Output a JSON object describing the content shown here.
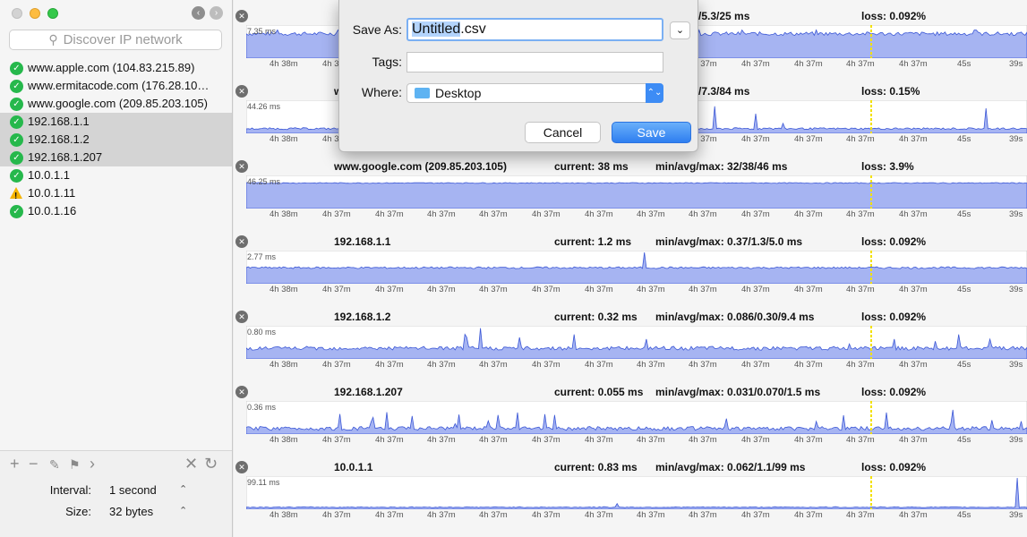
{
  "search": {
    "placeholder": "Discover IP network"
  },
  "hosts": [
    {
      "label": "www.apple.com (104.83.215.89)",
      "status": "ok",
      "selected": false
    },
    {
      "label": "www.ermitacode.com (176.28.10…",
      "status": "ok",
      "selected": false
    },
    {
      "label": "www.google.com (209.85.203.105)",
      "status": "ok",
      "selected": false
    },
    {
      "label": "192.168.1.1",
      "status": "ok",
      "selected": true
    },
    {
      "label": "192.168.1.2",
      "status": "ok",
      "selected": true
    },
    {
      "label": "192.168.1.207",
      "status": "ok",
      "selected": true
    },
    {
      "label": "10.0.1.1",
      "status": "ok",
      "selected": false
    },
    {
      "label": "10.0.1.11",
      "status": "warn",
      "selected": false
    },
    {
      "label": "10.0.1.16",
      "status": "ok",
      "selected": false
    }
  ],
  "settings": {
    "interval_label": "Interval:",
    "interval_value": "1 second",
    "size_label": "Size:",
    "size_value": "32 bytes"
  },
  "time_ticks": [
    "4h 38m",
    "4h 37m",
    "4h 37m",
    "4h 37m",
    "4h 37m",
    "4h 37m",
    "4h 37m",
    "4h 37m",
    "4h 37m",
    "4h 37m",
    "4h 37m",
    "4h 37m",
    "4h 37m",
    "45s",
    "39s"
  ],
  "graphs": [
    {
      "host": "",
      "current": "",
      "minavgmax": "max: 4.7/5.3/25 ms",
      "loss": "loss: 0.092%",
      "ymax": "7.35 ms",
      "style": "flat"
    },
    {
      "host": "w",
      "current": "",
      "minavgmax": "max: 5.4/7.3/84 ms",
      "loss": "loss: 0.15%",
      "ymax": "44.26 ms",
      "style": "spiky-low"
    },
    {
      "host": "www.google.com (209.85.203.105)",
      "current": "current: 38 ms",
      "minavgmax": "min/avg/max: 32/38/46 ms",
      "loss": "loss: 3.9%",
      "ymax": "46.25 ms",
      "style": "full"
    },
    {
      "host": "192.168.1.1",
      "current": "current: 1.2 ms",
      "minavgmax": "min/avg/max: 0.37/1.3/5.0 ms",
      "loss": "loss: 0.092%",
      "ymax": "2.77 ms",
      "style": "mid"
    },
    {
      "host": "192.168.1.2",
      "current": "current: 0.32 ms",
      "minavgmax": "min/avg/max: 0.086/0.30/9.4 ms",
      "loss": "loss: 0.092%",
      "ymax": "0.80 ms",
      "style": "noisy"
    },
    {
      "host": "192.168.1.207",
      "current": "current: 0.055 ms",
      "minavgmax": "min/avg/max: 0.031/0.070/1.5 ms",
      "loss": "loss: 0.092%",
      "ymax": "0.36 ms",
      "style": "spiky"
    },
    {
      "host": "10.0.1.1",
      "current": "current: 0.83 ms",
      "minavgmax": "min/avg/max: 0.062/1.1/99 ms",
      "loss": "loss: 0.092%",
      "ymax": "99.11 ms",
      "style": "low"
    }
  ],
  "dialog": {
    "saveas_label": "Save As:",
    "filename_base": "Untitled",
    "filename_ext": ".csv",
    "tags_label": "Tags:",
    "where_label": "Where:",
    "where_value": "Desktop",
    "cancel_label": "Cancel",
    "save_label": "Save"
  },
  "colors": {
    "accent": "#3d8cf5",
    "graph_fill": "#a6b4f2",
    "graph_line": "#3b57d6",
    "marker": "#f3e100"
  }
}
